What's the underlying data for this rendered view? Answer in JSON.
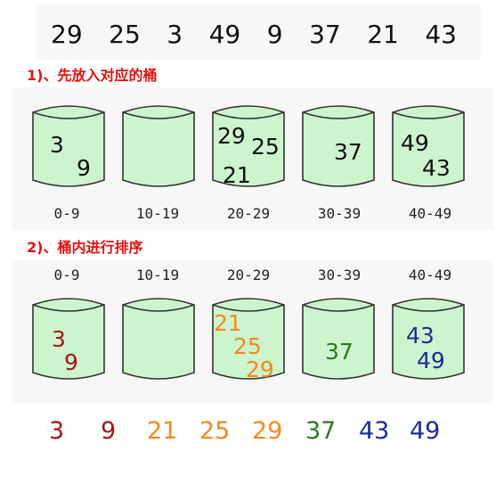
{
  "input_numbers": [
    "29",
    "25",
    "3",
    "49",
    "9",
    "37",
    "21",
    "43"
  ],
  "step1": {
    "title": "1)、先放入对应的桶",
    "buckets": [
      {
        "range": "0-9",
        "items": [
          "3",
          "9"
        ]
      },
      {
        "range": "10-19",
        "items": []
      },
      {
        "range": "20-29",
        "items": [
          "29",
          "25",
          "21"
        ]
      },
      {
        "range": "30-39",
        "items": [
          "37"
        ]
      },
      {
        "range": "40-49",
        "items": [
          "49",
          "43"
        ]
      }
    ]
  },
  "step2": {
    "title": "2)、桶内进行排序",
    "buckets": [
      {
        "range": "0-9",
        "items": [
          "3",
          "9"
        ]
      },
      {
        "range": "10-19",
        "items": []
      },
      {
        "range": "20-29",
        "items": [
          "21",
          "25",
          "29"
        ]
      },
      {
        "range": "30-39",
        "items": [
          "37"
        ]
      },
      {
        "range": "40-49",
        "items": [
          "43",
          "49"
        ]
      }
    ]
  },
  "result": [
    "3",
    "9",
    "21",
    "25",
    "29",
    "37",
    "43",
    "49"
  ],
  "colors": {
    "bucket_fill": "#cdf5cd",
    "bucket_stroke": "#333333",
    "title": "#e8110f",
    "group_0_9": "#a01818",
    "group_20_29": "#f58a1f",
    "group_30_39": "#2a7a1e",
    "group_40_49": "#1f2a9a"
  }
}
